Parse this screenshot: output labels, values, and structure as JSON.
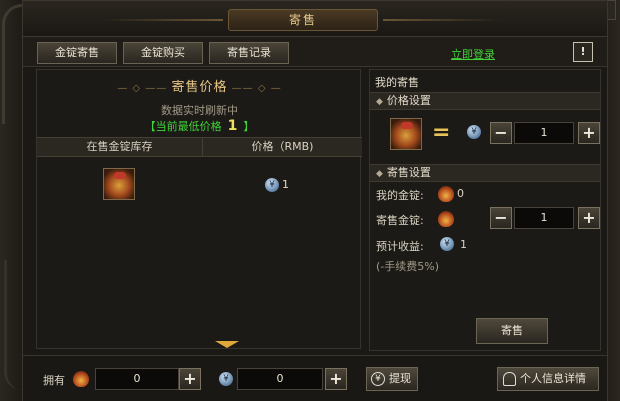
{
  "window": {
    "title": "寄售"
  },
  "toolbar": {
    "tabs": [
      {
        "label": "金锭寄售"
      },
      {
        "label": "金锭购买"
      },
      {
        "label": "寄售记录"
      }
    ],
    "login_link": "立即登录",
    "warn_label": "!"
  },
  "left": {
    "title": "寄售价格",
    "refresh_note": "数据实时刷新中",
    "lowest_prefix": "【当前最低价格",
    "lowest_value": "1",
    "lowest_suffix": "】",
    "columns": [
      "在售金锭库存",
      "价格（RMB)"
    ],
    "rows": [
      {
        "item_icon": "gold-ingot-bag-icon",
        "price": "1"
      }
    ]
  },
  "right": {
    "title": "我的寄售",
    "price_section": "价格设置",
    "price_value": "1",
    "consign_section": "寄售设置",
    "my_gold_label": "我的金锭:",
    "my_gold_value": "0",
    "consign_gold_label": "寄售金锭:",
    "consign_gold_value": "1",
    "expected_label": "预计收益:",
    "expected_value": "1",
    "fee_note": "(-手续费5%)",
    "sell_button": "寄售"
  },
  "bottom": {
    "own_label": "拥有",
    "gold_value": "0",
    "rmb_value": "0",
    "withdraw_label": "提现",
    "profile_label": "个人信息详情"
  },
  "colors": {
    "accent_gold": "#e8c686",
    "link_green": "#41d338",
    "highlight_yellow": "#f2e25b"
  }
}
